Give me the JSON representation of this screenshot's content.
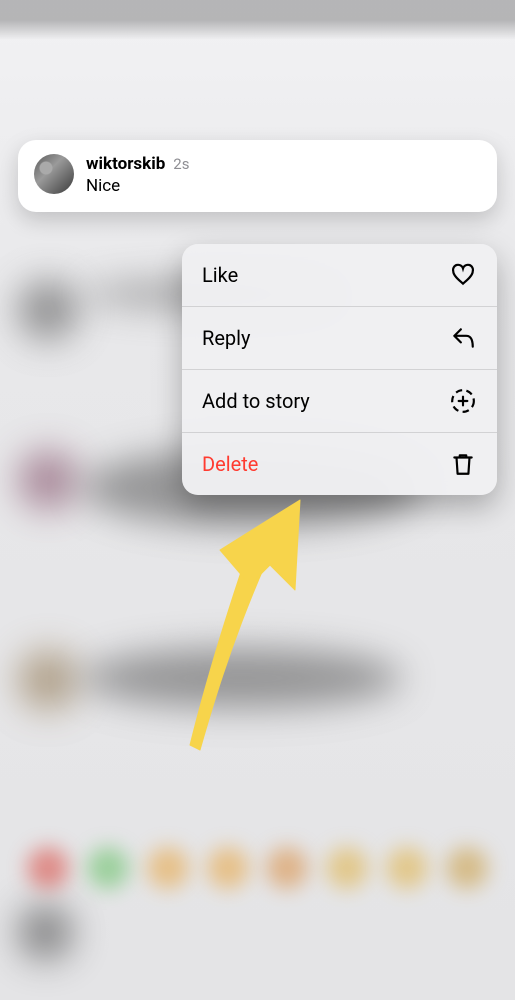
{
  "comment": {
    "username": "wiktorskib",
    "timestamp": "2s",
    "text": "Nice"
  },
  "menu": {
    "like_label": "Like",
    "reply_label": "Reply",
    "add_story_label": "Add to story",
    "delete_label": "Delete"
  },
  "colors": {
    "danger": "#ff3b30"
  }
}
